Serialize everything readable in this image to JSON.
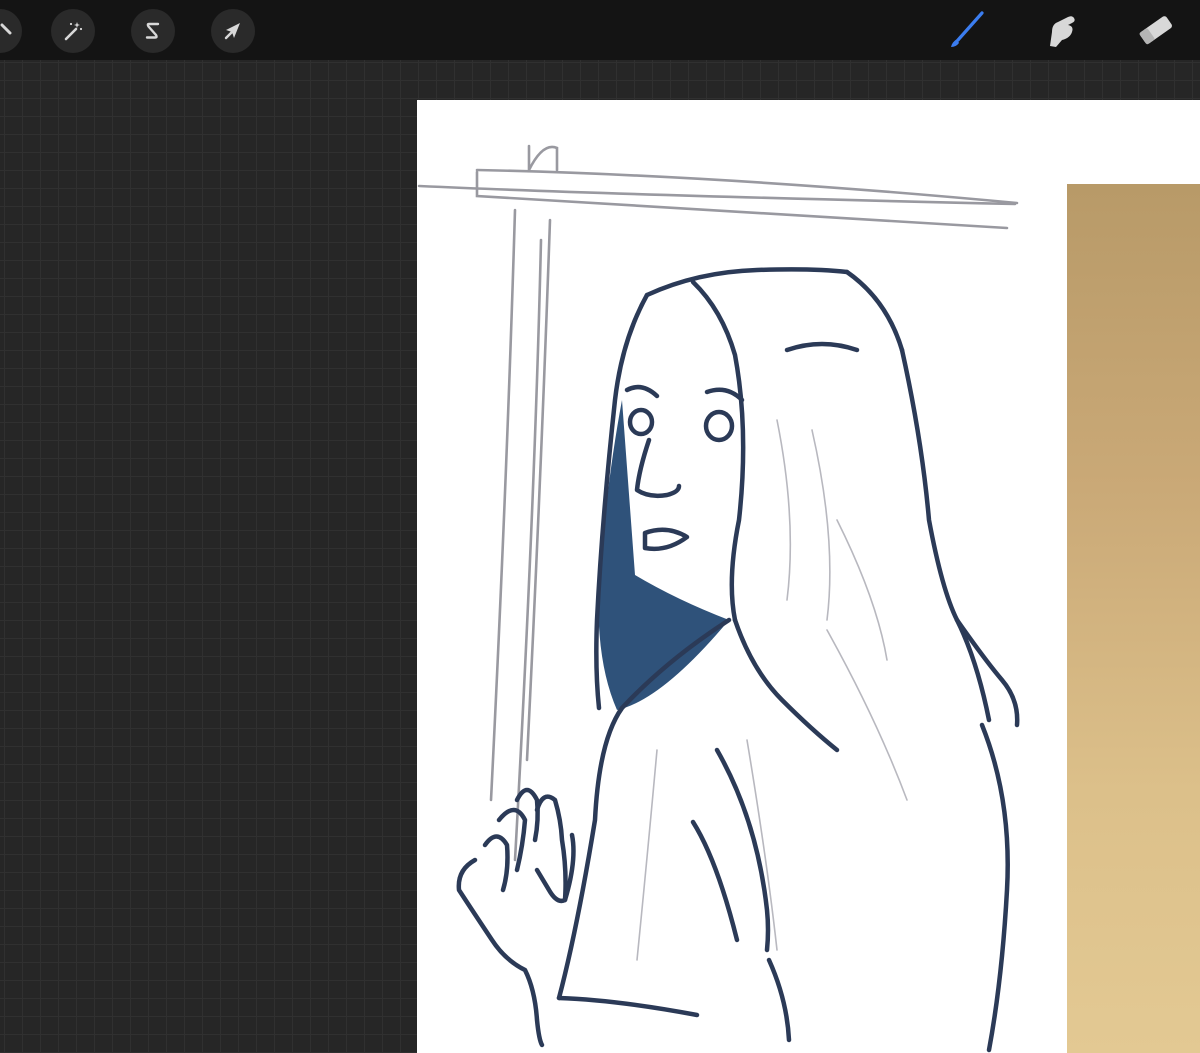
{
  "toolbar": {
    "left_tools": [
      {
        "name": "modify",
        "icon": "wrench-icon"
      },
      {
        "name": "adjustments",
        "icon": "magic-wand-icon"
      },
      {
        "name": "selection",
        "icon": "selection-s-icon"
      },
      {
        "name": "transform",
        "icon": "arrow-cursor-icon"
      }
    ],
    "right_tools": [
      {
        "name": "brush",
        "icon": "brush-icon",
        "active": true
      },
      {
        "name": "smudge",
        "icon": "smudge-finger-icon",
        "active": false
      },
      {
        "name": "eraser",
        "icon": "eraser-icon",
        "active": false
      }
    ]
  },
  "colors": {
    "toolbar_bg": "#141414",
    "workspace_bg": "#262626",
    "active_tool": "#3b7df0",
    "inactive_tool": "#d8d8d8",
    "ink": "#2b3a57",
    "hair_shadow": "#2f527a",
    "construction": "#8e8e96",
    "reference_photo": "#caa977"
  }
}
